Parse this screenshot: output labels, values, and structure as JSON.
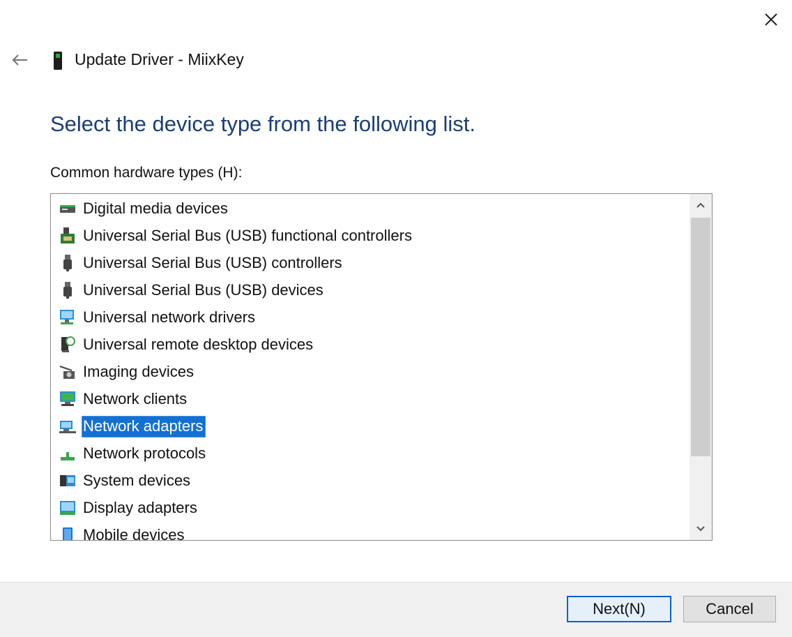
{
  "window": {
    "title": "Update Driver - MiixKey",
    "close_icon": "close-icon",
    "back_icon": "back-arrow-icon",
    "device_icon": "usb-key-icon"
  },
  "heading": "Select the device type from the following list.",
  "list": {
    "label": "Common hardware types (H):",
    "selected_index": 8,
    "items": [
      {
        "label": "Digital media devices",
        "icon": "digital-media-icon"
      },
      {
        "label": "Universal Serial Bus (USB) functional controllers",
        "icon": "usb-function-controller-icon"
      },
      {
        "label": "Universal Serial Bus (USB) controllers",
        "icon": "usb-plug-icon"
      },
      {
        "label": "Universal Serial Bus (USB) devices",
        "icon": "usb-plug-icon"
      },
      {
        "label": "Universal network drivers",
        "icon": "network-driver-icon"
      },
      {
        "label": "Universal remote desktop devices",
        "icon": "remote-desktop-icon"
      },
      {
        "label": "Imaging devices",
        "icon": "camera-icon"
      },
      {
        "label": "Network clients",
        "icon": "network-client-icon"
      },
      {
        "label": "Network adapters",
        "icon": "network-adapter-icon"
      },
      {
        "label": "Network protocols",
        "icon": "network-protocol-icon"
      },
      {
        "label": "System devices",
        "icon": "system-devices-icon"
      },
      {
        "label": "Display adapters",
        "icon": "display-adapter-icon"
      },
      {
        "label": "Mobile devices",
        "icon": "mobile-device-icon"
      }
    ]
  },
  "buttons": {
    "next": "Next(N)",
    "cancel": "Cancel"
  },
  "colors": {
    "heading": "#1a3e78",
    "selection": "#1470d2",
    "accent_border": "#0a62c8"
  }
}
